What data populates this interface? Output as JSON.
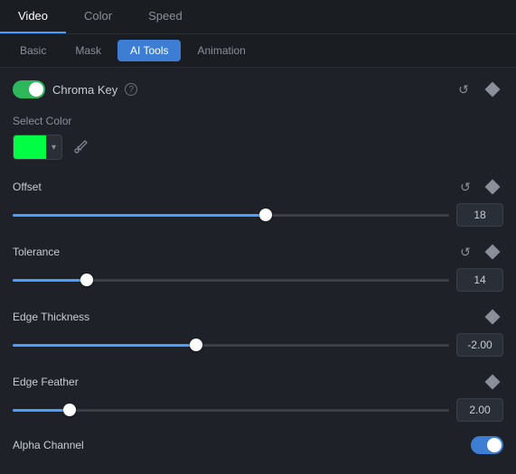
{
  "topTabs": [
    {
      "label": "Video",
      "active": true
    },
    {
      "label": "Color",
      "active": false
    },
    {
      "label": "Speed",
      "active": false
    }
  ],
  "secondTabs": [
    {
      "label": "Basic",
      "active": false
    },
    {
      "label": "Mask",
      "active": false
    },
    {
      "label": "AI Tools",
      "active": true
    },
    {
      "label": "Animation",
      "active": false
    }
  ],
  "chromaKey": {
    "label": "Chroma Key",
    "enabled": true
  },
  "selectColor": {
    "label": "Select Color",
    "color": "#00ff44"
  },
  "sliders": [
    {
      "id": "offset",
      "label": "Offset",
      "value": "18",
      "thumbPercent": 58,
      "fillPercent": 58,
      "hasReset": true,
      "hasDiamond": true
    },
    {
      "id": "tolerance",
      "label": "Tolerance",
      "value": "14",
      "thumbPercent": 17,
      "fillPercent": 17,
      "hasReset": true,
      "hasDiamond": true
    },
    {
      "id": "edge-thickness",
      "label": "Edge Thickness",
      "value": "-2.00",
      "thumbPercent": 42,
      "fillPercent": 42,
      "hasReset": false,
      "hasDiamond": true
    },
    {
      "id": "edge-feather",
      "label": "Edge Feather",
      "value": "2.00",
      "thumbPercent": 13,
      "fillPercent": 13,
      "hasReset": false,
      "hasDiamond": true
    }
  ],
  "alphaChannel": {
    "label": "Alpha Channel",
    "enabled": true
  }
}
